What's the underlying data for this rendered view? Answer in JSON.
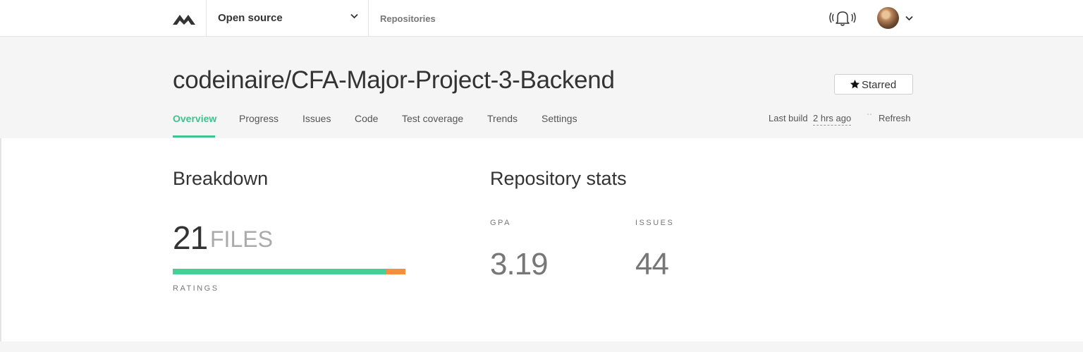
{
  "nav": {
    "org_label": "Open source",
    "repositories_label": "Repositories"
  },
  "repo": {
    "title": "codeinaire/CFA-Major-Project-3-Backend",
    "star_label": "Starred"
  },
  "tabs": [
    {
      "label": "Overview",
      "active": true
    },
    {
      "label": "Progress"
    },
    {
      "label": "Issues"
    },
    {
      "label": "Code"
    },
    {
      "label": "Test coverage"
    },
    {
      "label": "Trends"
    },
    {
      "label": "Settings"
    }
  ],
  "build": {
    "prefix": "Last build",
    "time": "2 hrs ago",
    "refresh_label": "Refresh"
  },
  "breakdown": {
    "heading": "Breakdown",
    "count": "21",
    "unit": "FILES",
    "ratings_label": "RATINGS",
    "rating_segments": [
      {
        "grade": "A",
        "fraction": 0.917,
        "color": "#45d195"
      },
      {
        "grade": "B",
        "fraction": 0.083,
        "color": "#f3903d"
      }
    ]
  },
  "stats": {
    "heading": "Repository stats",
    "gpa_label": "GPA",
    "gpa_value": "3.19",
    "issues_label": "ISSUES",
    "issues_value": "44"
  },
  "colors": {
    "accent": "#3ec28f",
    "header_bg": "#f5f5f5"
  }
}
